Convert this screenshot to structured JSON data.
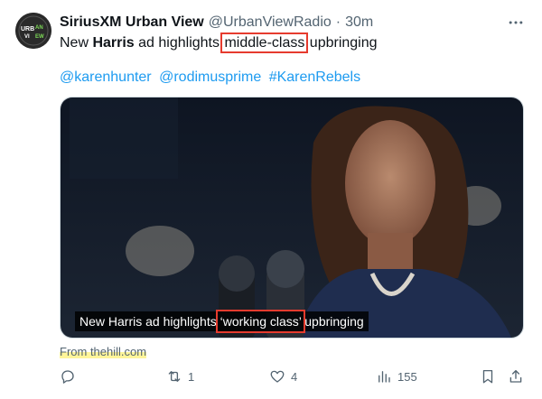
{
  "account": {
    "name": "SiriusXM Urban View",
    "handle": "@UrbanViewRadio",
    "separator": "·",
    "time": "30m",
    "avatar_text": "URBAN VIEW"
  },
  "tweet": {
    "text_before": "New ",
    "text_bold": "Harris",
    "text_mid": " ad highlights ",
    "text_highlight": "middle-class",
    "text_after": " upbringing",
    "tags": [
      "@karenhunter",
      "@rodimusprime",
      "#KarenRebels"
    ]
  },
  "media": {
    "caption_before": "New Harris ad highlights ",
    "caption_highlight": "‘working class’",
    "caption_after": " upbringing"
  },
  "source": "From thehill.com",
  "actions": {
    "reply_count": "",
    "retweet_count": "1",
    "like_count": "4",
    "views_count": "155"
  },
  "icons": [
    "more-icon",
    "reply-icon",
    "retweet-icon",
    "like-icon",
    "views-icon",
    "bookmark-icon",
    "share-icon"
  ],
  "colors": {
    "link": "#1d9bf0",
    "annotation_red": "#e63b2e",
    "highlighter": "#fff59a"
  }
}
